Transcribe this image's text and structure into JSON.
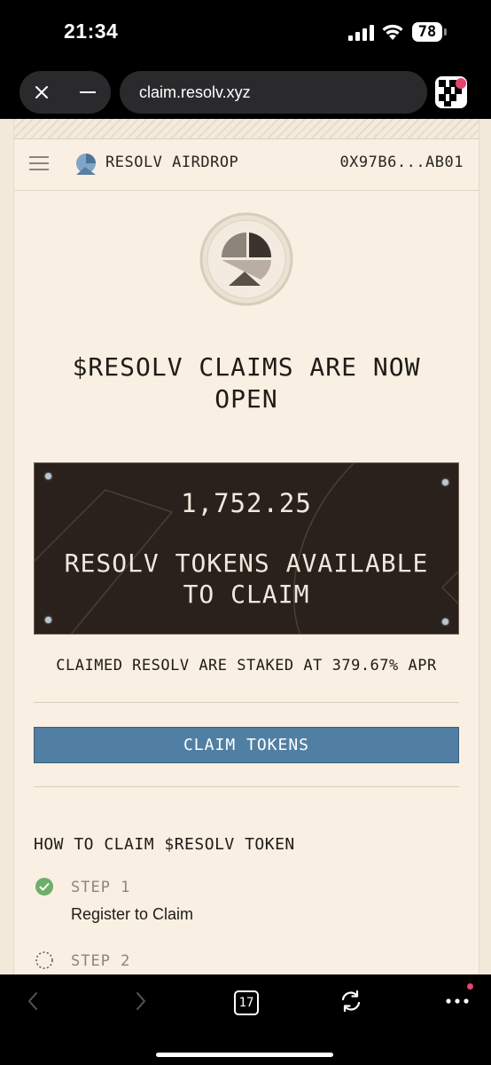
{
  "status": {
    "time": "21:34",
    "battery": "78"
  },
  "browser": {
    "url": "claim.resolv.xyz",
    "tabs_count": "17"
  },
  "header": {
    "brand": "RESOLV AIRDROP",
    "wallet": "0X97B6...AB01"
  },
  "hero": {
    "headline_line1": "$RESOLV CLAIMS ARE NOW",
    "headline_line2": "OPEN"
  },
  "token_card": {
    "amount": "1,752.25",
    "label_line1": "RESOLV TOKENS AVAILABLE",
    "label_line2": "TO CLAIM"
  },
  "staking": {
    "apr_text": "CLAIMED RESOLV ARE STAKED AT 379.67% APR"
  },
  "claim_button": {
    "label": "CLAIM TOKENS"
  },
  "how_to": {
    "title": "HOW TO CLAIM $RESOLV TOKEN",
    "steps": [
      {
        "label": "STEP 1",
        "description": "Register to Claim",
        "status": "complete"
      },
      {
        "label": "STEP 2",
        "status": "pending"
      }
    ]
  },
  "colors": {
    "page_bg": "#f9efe2",
    "card_bg": "#2a211c",
    "button_bg": "#517fa3",
    "step_complete": "#6fae6a"
  }
}
